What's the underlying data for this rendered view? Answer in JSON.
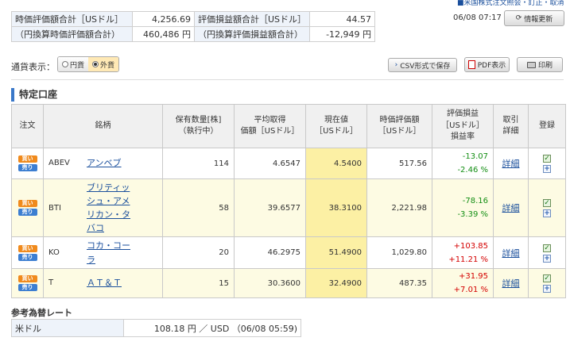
{
  "top_link": "■米国株式注文照会・訂正・取消",
  "summary": {
    "row1": {
      "label1": "時価評価額合計［USドル］",
      "value1": "4,256.69",
      "label2": "評価損益額合計［USドル］",
      "value2": "44.57"
    },
    "row2": {
      "label1": "（円換算時価評価額合計）",
      "value1": "460,486 円",
      "label2": "（円換算評価損益額合計）",
      "value2": "-12,949 円"
    }
  },
  "datetime": "06/08 07:17",
  "refresh_label": "情報更新",
  "currency": {
    "label": "通貨表示：",
    "options": [
      "円貨",
      "外貨"
    ],
    "selected": "外貨"
  },
  "actions": {
    "csv": "CSV形式で保存",
    "pdf": "PDF表示",
    "print": "印刷"
  },
  "section_title": "特定口座",
  "table": {
    "headers": {
      "order": "注文",
      "name": "銘柄",
      "qty1": "保有数量[株]",
      "qty2": "（執行中）",
      "avg1": "平均取得",
      "avg2": "価額［USドル］",
      "price1": "現在値",
      "price2": "［USドル］",
      "mv1": "時価評価額",
      "mv2": "［USドル］",
      "pl1": "評価損益",
      "pl2": "［USドル］",
      "pl3": "損益率",
      "detail1": "取引",
      "detail2": "詳細",
      "register": "登録"
    },
    "buy_label": "買い",
    "sell_label": "売り",
    "detail_label": "詳細",
    "rows": [
      {
        "ticker": "ABEV",
        "name_lines": [
          "アンベブ"
        ],
        "qty": "114",
        "avg_cost": "4.6547",
        "price": "4.5400",
        "market_value": "517.56",
        "pl": "-13.07",
        "pl_pct": "-2.46 %"
      },
      {
        "ticker": "BTI",
        "name_lines": [
          "ブリティッ",
          "シュ・アメ",
          "リカン・タ",
          "バコ"
        ],
        "qty": "58",
        "avg_cost": "39.6577",
        "price": "38.3100",
        "market_value": "2,221.98",
        "pl": "-78.16",
        "pl_pct": "-3.39 %"
      },
      {
        "ticker": "KO",
        "name_lines": [
          "コカ・コー",
          "ラ"
        ],
        "qty": "20",
        "avg_cost": "46.2975",
        "price": "51.4900",
        "market_value": "1,029.80",
        "pl": "+103.85",
        "pl_pct": "+11.21 %"
      },
      {
        "ticker": "T",
        "name_lines": [
          "ＡＴ＆Ｔ"
        ],
        "qty": "15",
        "avg_cost": "30.3600",
        "price": "32.4900",
        "market_value": "487.35",
        "pl": "+31.95",
        "pl_pct": "+7.01 %"
      }
    ]
  },
  "rate": {
    "title": "参考為替レート",
    "label": "米ドル",
    "value": "108.18 円 ／ USD （06/08 05:59)"
  },
  "colors": {
    "accent": "#3a78c9",
    "positive": "#d40000",
    "negative": "#138e13",
    "current_price_bg": "#fcf0a4",
    "row_alt_bg": "#fdfbe3"
  }
}
